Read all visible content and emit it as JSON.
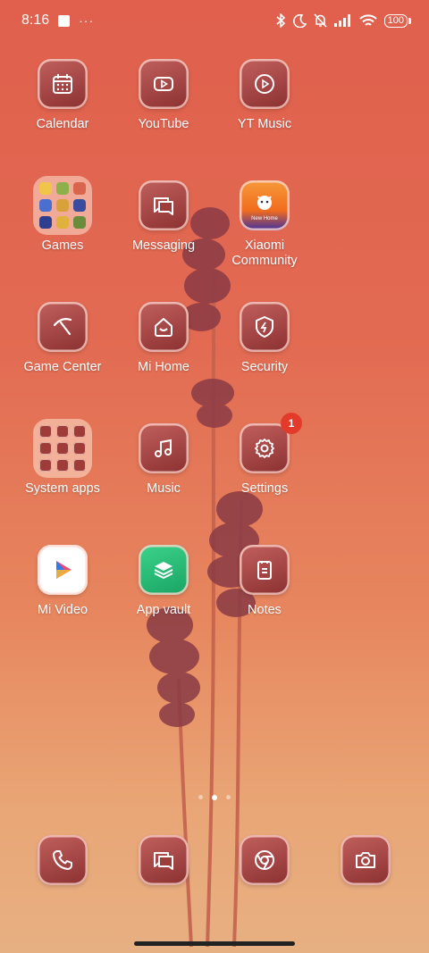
{
  "status_bar": {
    "time": "8:16",
    "left_icons": [
      "notification-square-icon",
      "more-dots-icon"
    ],
    "right_icons": [
      "bluetooth-icon",
      "moon-icon",
      "bell-muted-icon",
      "signal-icon",
      "wifi-icon"
    ],
    "battery": "100"
  },
  "apps": [
    {
      "label": "Calendar",
      "icon": "calendar-icon"
    },
    {
      "label": "YouTube",
      "icon": "youtube-icon"
    },
    {
      "label": "YT Music",
      "icon": "yt-music-icon"
    },
    {
      "label": "Games",
      "icon": "folder-icon"
    },
    {
      "label": "Messaging",
      "icon": "messaging-icon"
    },
    {
      "label": "Xiaomi Community",
      "icon": "xiaomi-community-icon",
      "subtext": "New Home"
    },
    {
      "label": "Game Center",
      "icon": "game-center-icon"
    },
    {
      "label": "Mi Home",
      "icon": "mi-home-icon"
    },
    {
      "label": "Security",
      "icon": "security-shield-icon"
    },
    {
      "label": "System apps",
      "icon": "folder-icon"
    },
    {
      "label": "Music",
      "icon": "music-note-icon"
    },
    {
      "label": "Settings",
      "icon": "settings-gear-icon",
      "badge": "1"
    },
    {
      "label": "Mi Video",
      "icon": "mi-video-icon"
    },
    {
      "label": "App vault",
      "icon": "app-vault-icon"
    },
    {
      "label": "Notes",
      "icon": "notes-icon"
    }
  ],
  "dock": [
    {
      "icon": "phone-icon"
    },
    {
      "icon": "messaging-icon"
    },
    {
      "icon": "chrome-icon"
    },
    {
      "icon": "camera-icon"
    }
  ],
  "pager": {
    "pages": 3,
    "active": 1
  },
  "colors": {
    "badge": "#e23b2c",
    "icon_bg": "#8a2f30",
    "wallpaper_top": "#e0604d",
    "wallpaper_bottom": "#e7b082"
  }
}
